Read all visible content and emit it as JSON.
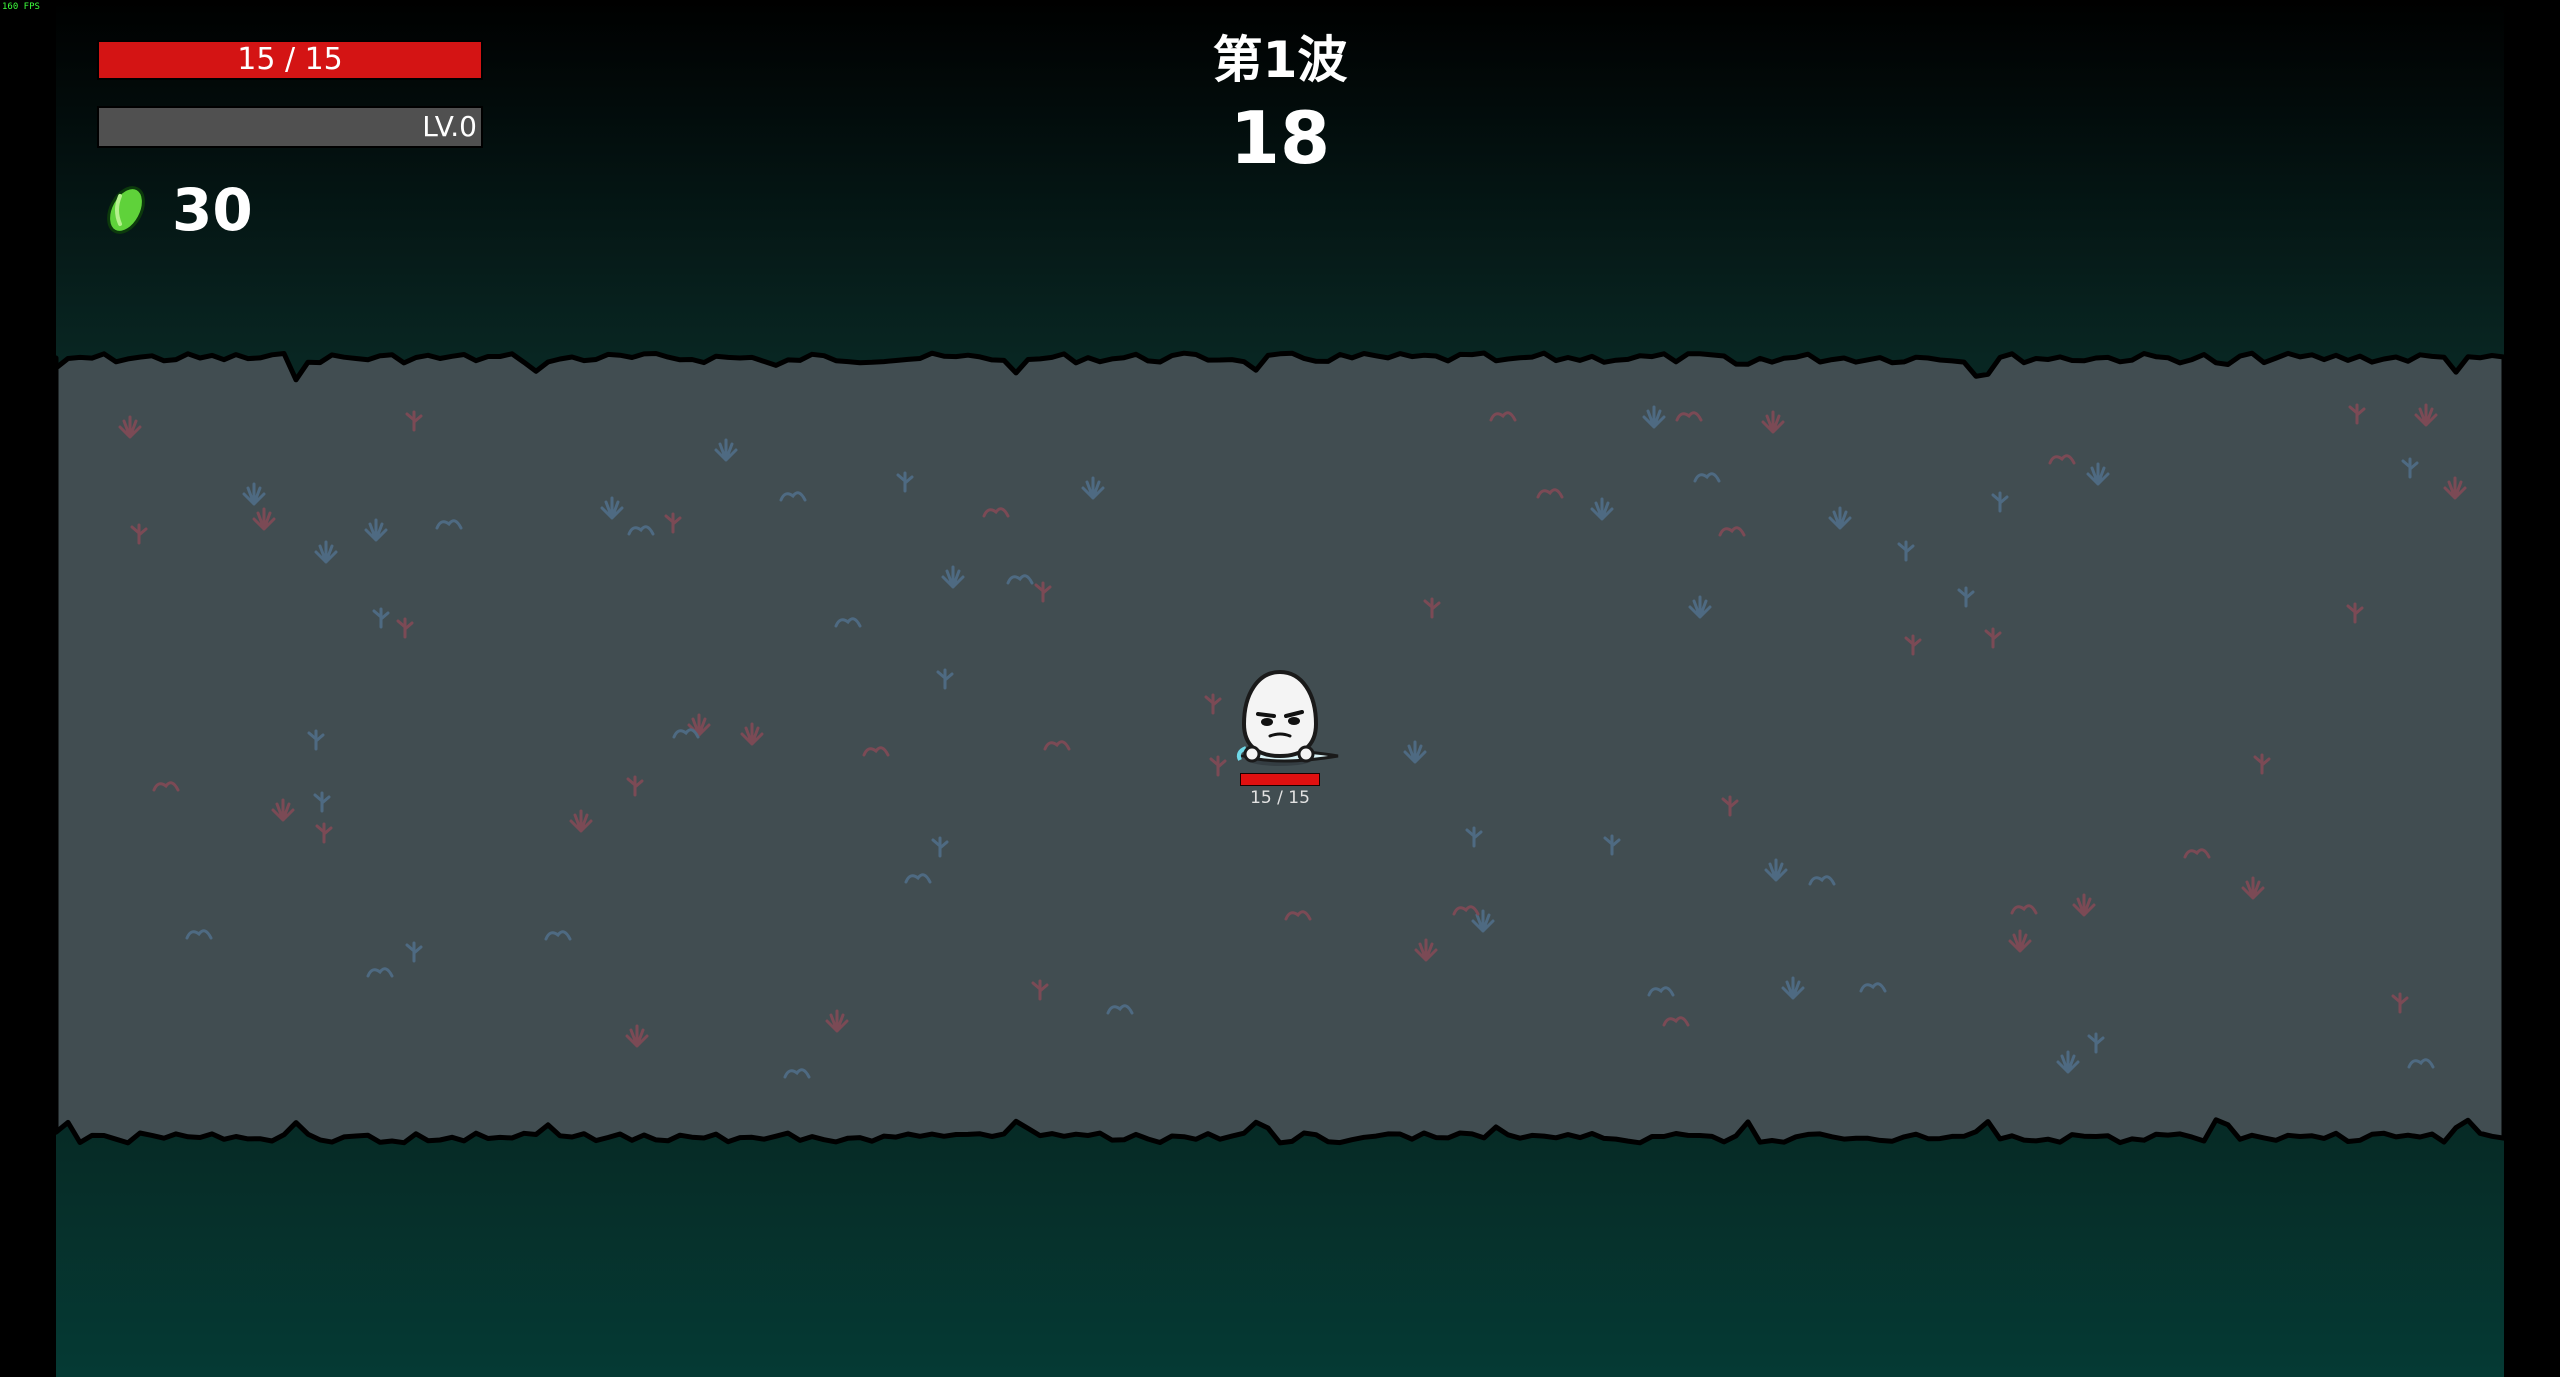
{
  "fps_label": "160 FPS",
  "hud": {
    "health": {
      "current": 15,
      "max": 15,
      "text": "15 / 15",
      "color": "#c40f0f"
    },
    "experience": {
      "level_text": "LV.0",
      "progress": 0,
      "color": "#505050"
    },
    "materials": {
      "count": "30",
      "icon": "green-material-icon"
    },
    "wave": {
      "title": "第1波",
      "timer": "18"
    }
  },
  "player": {
    "hp_text": "15 / 15",
    "hp_fraction": 1
  },
  "colors": {
    "arena_floor": "#414d51",
    "arena_border": "#000000",
    "outer_background": "#053a34",
    "plant_blue": "#4e6a82",
    "plant_red": "#7b4a55",
    "health_red": "#c40f0f",
    "material_green": "#5fd23a"
  }
}
